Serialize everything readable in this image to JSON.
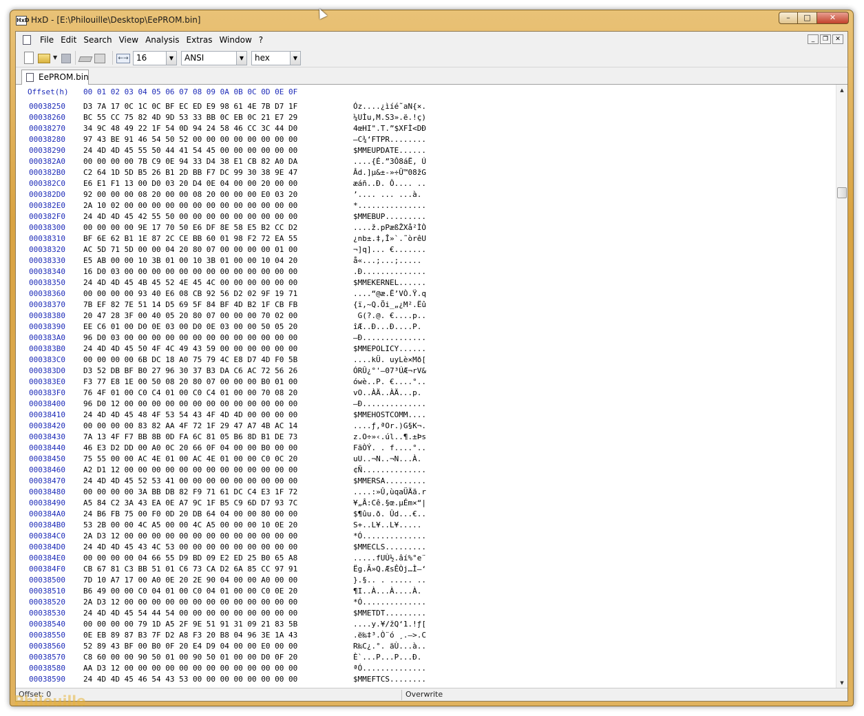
{
  "window": {
    "title": "HxD - [E:\\Philouille\\Desktop\\EePROM.bin]",
    "icon_label": "HxD",
    "controls": {
      "minimize": "–",
      "maximize": "□",
      "close": "✕"
    }
  },
  "menu": {
    "items": [
      "File",
      "Edit",
      "Search",
      "View",
      "Analysis",
      "Extras",
      "Window",
      "?"
    ],
    "mdi": {
      "minimize": "_",
      "restore": "❐",
      "close": "✕"
    }
  },
  "toolbar": {
    "width_icon_label": "←→",
    "bytes_per_row": "16",
    "charset": "ANSI",
    "offset_base": "hex",
    "dropdown_arrow": "▼"
  },
  "tab": {
    "label": "EePROM.bin"
  },
  "hex": {
    "offset_header": "Offset(h)",
    "column_header": "00 01 02 03 04 05 06 07 08 09 0A 0B 0C 0D 0E 0F",
    "rows": [
      {
        "offset": "00038250",
        "bytes": "D3 7A 17 0C 1C 0C BF EC ED E9 98 61 4E 7B D7 1F",
        "ascii": "Óz....¿ìíé˜aN{×."
      },
      {
        "offset": "00038260",
        "bytes": "BC 55 CC 75 82 4D 9D 53 33 BB 0C EB 0C 21 E7 29",
        "ascii": "¼UÌu‚M.S3».ë.!ç)"
      },
      {
        "offset": "00038270",
        "bytes": "34 9C 48 49 22 1F 54 0D 94 24 58 46 CC 3C 44 D0",
        "ascii": "4œHI\".T.”$XFÌ<DÐ"
      },
      {
        "offset": "00038280",
        "bytes": "97 43 BE 91 46 54 50 52 00 00 00 00 00 00 00 00",
        "ascii": "—C¾‘FTPR........"
      },
      {
        "offset": "00038290",
        "bytes": "24 4D 4D 45 55 50 44 41 54 45 00 00 00 00 00 00",
        "ascii": "$MMEUPDATE......"
      },
      {
        "offset": "000382A0",
        "bytes": "00 00 00 00 7B C9 0E 94 33 D4 38 E1 CB 82 A0 DA",
        "ascii": "....{É.”3Ô8áË‚ Ú"
      },
      {
        "offset": "000382B0",
        "bytes": "C2 64 1D 5D B5 26 B1 2D BB F7 DC 99 30 38 9E 47",
        "ascii": "Âd.]µ&±-»÷Ü™08žG"
      },
      {
        "offset": "000382C0",
        "bytes": "E6 E1 F1 13 00 D0 03 20 D4 0E 04 00 00 20 00 00",
        "ascii": "æáñ..Ð. Ô.... .."
      },
      {
        "offset": "000382D0",
        "bytes": "92 00 00 00 08 20 00 00 08 20 00 00 00 E0 03 20",
        "ascii": "’.... ... ...à. "
      },
      {
        "offset": "000382E0",
        "bytes": "2A 10 02 00 00 00 00 00 00 00 00 00 00 00 00 00",
        "ascii": "*..............."
      },
      {
        "offset": "000382F0",
        "bytes": "24 4D 4D 45 42 55 50 00 00 00 00 00 00 00 00 00",
        "ascii": "$MMEBUP........."
      },
      {
        "offset": "00038300",
        "bytes": "00 00 00 00 9E 17 70 50 E6 DF 8E 58 E5 B2 CC D2",
        "ascii": "....ž.pPæßŽXå²ÌÒ"
      },
      {
        "offset": "00038310",
        "bytes": "BF 6E 62 B1 1E 87 2C CE BB 60 01 98 F2 72 EA 55",
        "ascii": "¿nb±.‡,Î»`.˜òrêU"
      },
      {
        "offset": "00038320",
        "bytes": "AC 5D 71 5D 00 00 04 20 80 07 00 00 00 00 01 00",
        "ascii": "¬]q]... €......."
      },
      {
        "offset": "00038330",
        "bytes": "E5 AB 00 00 10 3B 01 00 10 3B 01 00 00 10 04 20",
        "ascii": "å«...;...;..... "
      },
      {
        "offset": "00038340",
        "bytes": "16 D0 03 00 00 00 00 00 00 00 00 00 00 00 00 00",
        "ascii": ".Ð.............."
      },
      {
        "offset": "00038350",
        "bytes": "24 4D 4D 45 4B 45 52 4E 45 4C 00 00 00 00 00 00",
        "ascii": "$MMEKERNEL......"
      },
      {
        "offset": "00038360",
        "bytes": "00 00 00 00 93 40 E6 08 CB 92 56 D2 02 9F 19 71",
        "ascii": "....“@æ.Ë’VÒ.Ÿ.q"
      },
      {
        "offset": "00038370",
        "bytes": "7B EF 82 7E 51 14 D5 69 5F 84 BF 4D B2 1F CB FB",
        "ascii": "{ï‚~Q.Õi_„¿M².Ëû"
      },
      {
        "offset": "00038380",
        "bytes": "20 47 28 3F 00 40 05 20 80 07 00 00 00 70 02 00",
        "ascii": " G(?.@. €....p.."
      },
      {
        "offset": "00038390",
        "bytes": "EE C6 01 00 D0 0E 03 00 D0 0E 03 00 00 50 05 20",
        "ascii": "îÆ..Ð...Ð....P. "
      },
      {
        "offset": "000383A0",
        "bytes": "96 D0 03 00 00 00 00 00 00 00 00 00 00 00 00 00",
        "ascii": "–Ð.............."
      },
      {
        "offset": "000383B0",
        "bytes": "24 4D 4D 45 50 4F 4C 49 43 59 00 00 00 00 00 00",
        "ascii": "$MMEPOLICY......"
      },
      {
        "offset": "000383C0",
        "bytes": "00 00 00 00 6B DC 18 A0 75 79 4C E8 D7 4D F0 5B",
        "ascii": "....kÜ. uyLè×Mð["
      },
      {
        "offset": "000383D0",
        "bytes": "D3 52 DB BF B0 27 96 30 37 B3 DA C6 AC 72 56 26",
        "ascii": "ÓRÛ¿°'–07³ÚÆ¬rV&"
      },
      {
        "offset": "000383E0",
        "bytes": "F3 77 E8 1E 00 50 08 20 80 07 00 00 00 B0 01 00",
        "ascii": "ówè..P. €....°.."
      },
      {
        "offset": "000383F0",
        "bytes": "76 4F 01 00 C0 C4 01 00 C0 C4 01 00 00 70 08 20",
        "ascii": "vO..ÀÄ..ÀÄ...p. "
      },
      {
        "offset": "00038400",
        "bytes": "96 D0 12 00 00 00 00 00 00 00 00 00 00 00 00 00",
        "ascii": "–Ð.............."
      },
      {
        "offset": "00038410",
        "bytes": "24 4D 4D 45 48 4F 53 54 43 4F 4D 4D 00 00 00 00",
        "ascii": "$MMEHOSTCOMM...."
      },
      {
        "offset": "00038420",
        "bytes": "00 00 00 00 83 82 AA 4F 72 1F 29 47 A7 4B AC 14",
        "ascii": "....ƒ‚ªOr.)G§K¬."
      },
      {
        "offset": "00038430",
        "bytes": "7A 13 4F F7 BB 8B 0D FA 6C 81 05 B6 8D B1 DE 73",
        "ascii": "z.O÷»‹.úl..¶.±Þs"
      },
      {
        "offset": "00038440",
        "bytes": "46 E3 D2 DD 00 A0 0C 20 66 0F 04 00 00 B0 00 00",
        "ascii": "FãÒÝ. . f....°.."
      },
      {
        "offset": "00038450",
        "bytes": "75 55 00 00 AC 4E 01 00 AC 4E 01 00 00 C0 0C 20",
        "ascii": "uU..¬N..¬N...À. "
      },
      {
        "offset": "00038460",
        "bytes": "A2 D1 12 00 00 00 00 00 00 00 00 00 00 00 00 00",
        "ascii": "¢Ñ.............."
      },
      {
        "offset": "00038470",
        "bytes": "24 4D 4D 45 52 53 41 00 00 00 00 00 00 00 00 00",
        "ascii": "$MMERSA........."
      },
      {
        "offset": "00038480",
        "bytes": "00 00 00 00 3A BB DB 82 F9 71 61 DC C4 E3 1F 72",
        "ascii": "....:»Û‚ùqaÜÄã.r"
      },
      {
        "offset": "00038490",
        "bytes": "A5 84 C2 3A 43 EA 0E A7 9C 1F B5 C9 6D D7 93 7C",
        "ascii": "¥„Â:Cê.§œ.µÉm×“|"
      },
      {
        "offset": "000384A0",
        "bytes": "24 B6 FB 75 00 F0 0D 20 DB 64 04 00 00 80 00 00",
        "ascii": "$¶ûu.ð. Ûd...€.."
      },
      {
        "offset": "000384B0",
        "bytes": "53 2B 00 00 4C A5 00 00 4C A5 00 00 00 10 0E 20",
        "ascii": "S+..L¥..L¥..... "
      },
      {
        "offset": "000384C0",
        "bytes": "2A D3 12 00 00 00 00 00 00 00 00 00 00 00 00 00",
        "ascii": "*Ó.............."
      },
      {
        "offset": "000384D0",
        "bytes": "24 4D 4D 45 43 4C 53 00 00 00 00 00 00 00 00 00",
        "ascii": "$MMECLS........."
      },
      {
        "offset": "000384E0",
        "bytes": "00 00 00 00 04 66 55 D9 BD 09 E2 ED 25 B0 65 A8",
        "ascii": ".....fUÙ½.âí%°e¨"
      },
      {
        "offset": "000384F0",
        "bytes": "CB 67 81 C3 BB 51 01 C6 73 CA D2 6A 85 CC 97 91",
        "ascii": "Ëg.Ã»Q.ÆsÊÒj…Ì—‘"
      },
      {
        "offset": "00038500",
        "bytes": "7D 10 A7 17 00 A0 0E 20 2E 90 04 00 00 A0 00 00",
        "ascii": "}.§.. . ..... .."
      },
      {
        "offset": "00038510",
        "bytes": "B6 49 00 00 C0 04 01 00 C0 04 01 00 00 C0 0E 20",
        "ascii": "¶I..À...À....À. "
      },
      {
        "offset": "00038520",
        "bytes": "2A D3 12 00 00 00 00 00 00 00 00 00 00 00 00 00",
        "ascii": "*Ó.............."
      },
      {
        "offset": "00038530",
        "bytes": "24 4D 4D 45 54 44 54 00 00 00 00 00 00 00 00 00",
        "ascii": "$MMETDT........."
      },
      {
        "offset": "00038540",
        "bytes": "00 00 00 00 79 1D A5 2F 9E 51 91 31 09 21 83 5B",
        "ascii": "....y.¥/žQ‘1.!ƒ["
      },
      {
        "offset": "00038550",
        "bytes": "0E EB 89 87 B3 7F D2 A8 F3 20 B8 04 96 3E 1A 43",
        "ascii": ".ë‰‡³.Ò¨ó ¸.–>.C"
      },
      {
        "offset": "00038560",
        "bytes": "52 89 43 BF 00 B0 0F 20 E4 D9 04 00 00 E0 00 00",
        "ascii": "R‰C¿.°. äÙ...à.."
      },
      {
        "offset": "00038570",
        "bytes": "C8 60 00 00 90 50 01 00 90 50 01 00 00 D0 0F 20",
        "ascii": "È`...P...P...Ð. "
      },
      {
        "offset": "00038580",
        "bytes": "AA D3 12 00 00 00 00 00 00 00 00 00 00 00 00 00",
        "ascii": "ªÓ.............."
      },
      {
        "offset": "00038590",
        "bytes": "24 4D 4D 45 46 54 43 53 00 00 00 00 00 00 00 00",
        "ascii": "$MMEFTCS........"
      }
    ]
  },
  "scrollbar": {
    "up": "▲",
    "down": "▼",
    "position": 0.16
  },
  "status": {
    "offset": "Offset: 0",
    "mode": "Overwrite"
  },
  "watermark": "Philouille"
}
